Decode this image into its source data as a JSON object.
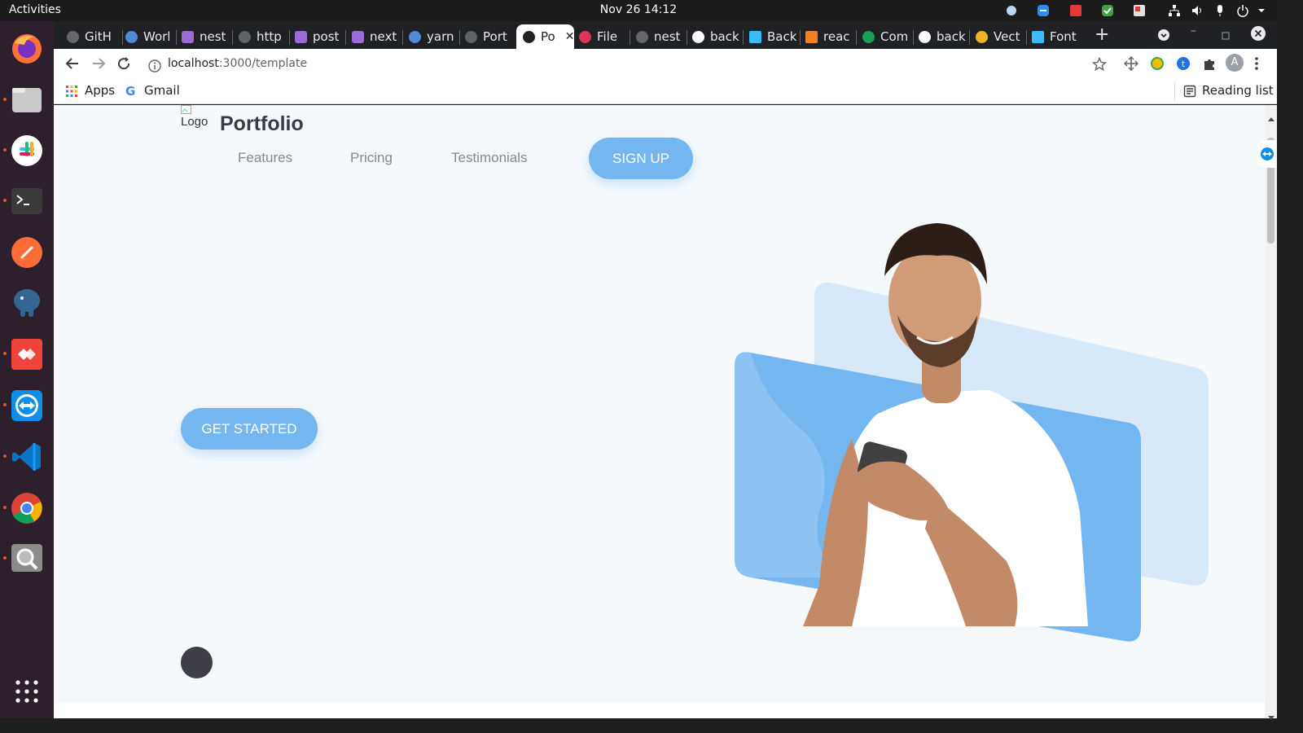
{
  "system": {
    "activities": "Activities",
    "datetime": "Nov 26  14:12"
  },
  "dock": {
    "apps": [
      "firefox-icon",
      "files-icon",
      "slack-icon",
      "terminal-icon",
      "postman-icon",
      "pgadmin-icon",
      "anydesk-icon",
      "teamviewer-icon",
      "vscode-icon",
      "chrome-icon",
      "magnifier-icon"
    ],
    "show_apps": "show-applications-icon"
  },
  "browser": {
    "tabs": [
      "GitH",
      "Worl",
      "nest",
      "http",
      "post",
      "next",
      "yarn",
      "Port",
      "Po",
      "File",
      "nest",
      "back",
      "Back",
      "reac",
      "Com",
      "back",
      "Vect",
      "Font"
    ],
    "url_host": "localhost",
    "url_path": ":3000/template",
    "bookmarks": {
      "apps": "Apps",
      "gmail": "Gmail",
      "reading_list": "Reading list"
    },
    "profile_initial": "A"
  },
  "site": {
    "logo_alt": "Logo",
    "brand": "Portfolio",
    "nav": {
      "features": "Features",
      "pricing": "Pricing",
      "testimonials": "Testimonials"
    },
    "signup": "SIGN UP",
    "cta": "GET STARTED"
  },
  "colors": {
    "accent": "#74b6ef",
    "page_bg": "#f5f9fc",
    "light_panel": "#d7e9f9"
  }
}
